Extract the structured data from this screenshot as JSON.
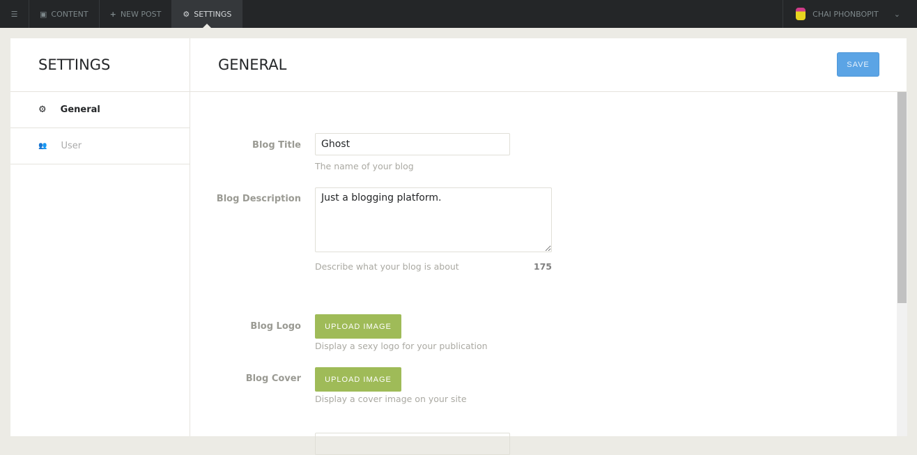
{
  "nav": {
    "items": [
      {
        "label": "CONTENT"
      },
      {
        "label": "NEW POST"
      },
      {
        "label": "SETTINGS"
      }
    ],
    "user": "CHAI PHONBOPIT"
  },
  "sidebar": {
    "title": "SETTINGS",
    "items": [
      {
        "label": "General"
      },
      {
        "label": "User"
      }
    ]
  },
  "main": {
    "title": "GENERAL",
    "save_label": "SAVE",
    "blog_title": {
      "label": "Blog Title",
      "value": "Ghost",
      "help": "The name of your blog"
    },
    "blog_description": {
      "label": "Blog Description",
      "value": "Just a blogging platform.",
      "help": "Describe what your blog is about",
      "count": "175"
    },
    "blog_logo": {
      "label": "Blog Logo",
      "button": "UPLOAD IMAGE",
      "help": "Display a sexy logo for your publication"
    },
    "blog_cover": {
      "label": "Blog Cover",
      "button": "UPLOAD IMAGE",
      "help": "Display a cover image on your site"
    }
  }
}
